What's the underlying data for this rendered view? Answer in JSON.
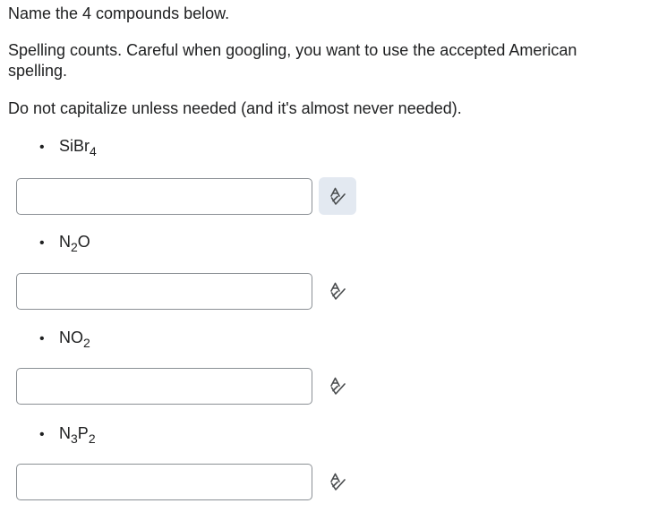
{
  "instructions": {
    "line1": "Name the 4 compounds below.",
    "line2": "Spelling counts. Careful when googling, you want to use the accepted American spelling.",
    "line3": "Do not capitalize unless needed (and it's almost never needed)."
  },
  "bullet_char": "•",
  "compounds": [
    {
      "parts": [
        "SiBr",
        "4"
      ]
    },
    {
      "parts": [
        "N",
        "2",
        "O"
      ]
    },
    {
      "parts": [
        "NO",
        "2"
      ]
    },
    {
      "parts": [
        "N",
        "3",
        "P",
        "2"
      ]
    }
  ],
  "answers": [
    {
      "value": "",
      "placeholder": ""
    },
    {
      "value": "",
      "placeholder": ""
    },
    {
      "value": "",
      "placeholder": ""
    },
    {
      "value": "",
      "placeholder": ""
    }
  ],
  "spellcheck": {
    "icon": "spellcheck-icon",
    "active_index": 0,
    "icon_color": "#494c4e",
    "active_bg": "#e3e9f1"
  }
}
